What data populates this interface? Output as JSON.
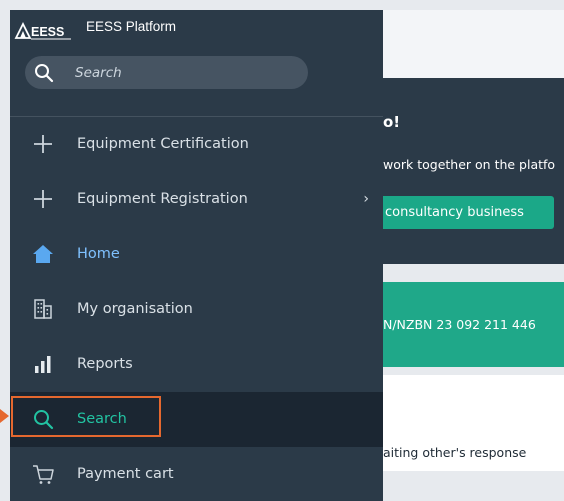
{
  "app": {
    "logo_text": "EESS",
    "name": "EESS Platform"
  },
  "search": {
    "placeholder": "Search"
  },
  "nav": {
    "items": [
      {
        "label": "Equipment Certification",
        "icon": "plus-icon"
      },
      {
        "label": "Equipment Registration",
        "icon": "plus-icon",
        "chevron": "›"
      },
      {
        "label": "Home",
        "icon": "home-icon"
      },
      {
        "label": "My organisation",
        "icon": "building-icon"
      },
      {
        "label": "Reports",
        "icon": "bar-chart-icon"
      },
      {
        "label": "Search",
        "icon": "search-icon",
        "active": true
      },
      {
        "label": "Payment cart",
        "icon": "cart-icon"
      }
    ]
  },
  "background": {
    "banner_heading": "o!",
    "banner_text": "work together on the platfo",
    "banner_button": "consultancy business",
    "green_text": "N/NZBN 23 092 211 446",
    "status_text": "aiting other's response"
  },
  "colors": {
    "sidebar_bg": "#2b3a48",
    "active_bg": "#1b2632",
    "active_text": "#22c3a2",
    "home_text": "#7fc1ff",
    "accent_green": "#1fa889",
    "highlight": "#e5682f"
  }
}
